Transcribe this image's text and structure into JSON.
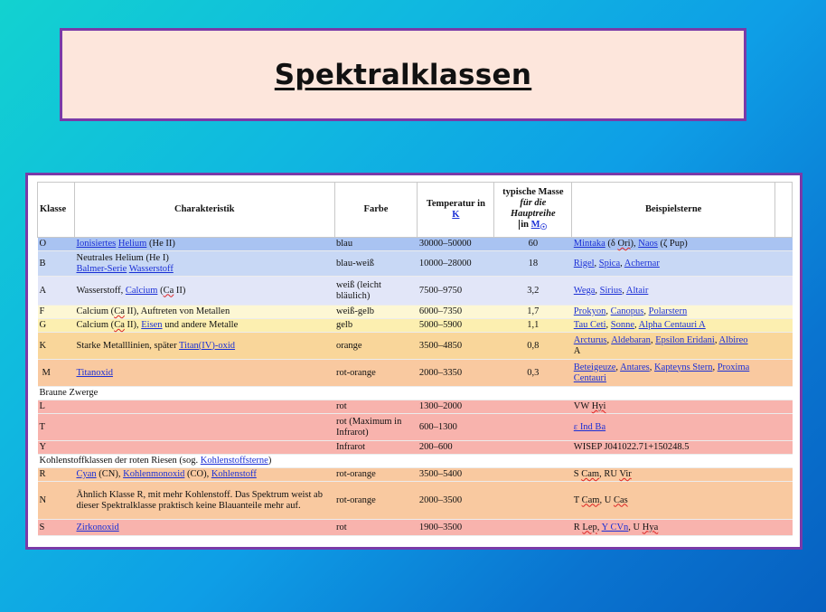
{
  "title": "Spektralklassen",
  "headers": {
    "klasse": "Klasse",
    "charakteristik": "Charakteristik",
    "farbe": "Farbe",
    "temperatur": "Temperatur in",
    "temperatur_unit": "K",
    "masse_line1": "typische Masse",
    "masse_line2": "für die",
    "masse_line3": "Hauptreihe",
    "masse_line4": "in",
    "masse_unit": "M",
    "masse_unit_sub": "☉",
    "beispiele": "Beispielsterne"
  },
  "rows": {
    "O": {
      "klasse": "O",
      "c1": "Ionisiertes",
      "c2": "Helium",
      "c3": " (He II)",
      "farbe": "blau",
      "temp": "30000–50000",
      "masse": "60",
      "b1": "Mintaka",
      "b2": " (δ ",
      "b3": "Ori",
      "b4": "), ",
      "b5": "Naos",
      "b6": " (ζ Pup)"
    },
    "B": {
      "klasse": "B",
      "c1": "Neutrales Helium  (He I)",
      "c2": "Balmer-Serie",
      "c3": "Wasserstoff",
      "farbe": "blau-weiß",
      "temp": "10000–28000",
      "masse": "18",
      "b1": "Rigel",
      "b2": "Spica",
      "b3": "Achernar"
    },
    "A": {
      "klasse": "A",
      "c1": "Wasserstoff, ",
      "c2": "Calcium",
      "c3": " (",
      "c4": "Ca",
      "c5": " II)",
      "farbe": "weiß (leicht bläulich)",
      "temp": "7500–9750",
      "masse": "3,2",
      "b1": "Wega",
      "b2": "Sirius",
      "b3": "Altair"
    },
    "F": {
      "klasse": "F",
      "c1": "Calcium (",
      "c2": "Ca",
      "c3": " II), Auftreten von Metallen",
      "farbe": "weiß-gelb",
      "temp": "6000–7350",
      "masse": "1,7",
      "b1": "Prokyon",
      "b2": "Canopus",
      "b3": "Polarstern"
    },
    "G": {
      "klasse": "G",
      "c1": "Calcium (",
      "c2": "Ca",
      "c3": " II), ",
      "c4": "Eisen",
      "c5": " und andere Metalle",
      "farbe": "gelb",
      "temp": "5000–5900",
      "masse": "1,1",
      "b1": "Tau Ceti",
      "b2": "Sonne",
      "b3": "Alpha Centauri A"
    },
    "K": {
      "klasse": "K",
      "c1": "Starke Metalllinien, später ",
      "c2": "Titan(IV)-oxid",
      "farbe": "orange",
      "temp": "3500–4850",
      "masse": "0,8",
      "b1": "Arcturus",
      "b2": "Aldebaran",
      "b3": "Epsilon Eridani",
      "b4": "Albireo",
      "b5": "A"
    },
    "M": {
      "klasse": "M",
      "c1": "Titanoxid",
      "farbe": "rot-orange",
      "temp": "2000–3350",
      "masse": "0,3",
      "b1": "Beteigeuze",
      "b2": "Antares",
      "b3": "Kapteyns Stern",
      "b4": "Proxima",
      "b5": "Centauri"
    },
    "braune": "Braune Zwerge",
    "L": {
      "klasse": "L",
      "farbe": "rot",
      "temp": "1300–2000",
      "b1": "VW ",
      "b2": "Hyi"
    },
    "T": {
      "klasse": "T",
      "farbe": "rot (Maximum in Infrarot)",
      "temp": "600–1300",
      "b1": "ε Ind Ba"
    },
    "Y": {
      "klasse": "Y",
      "farbe": "Infrarot",
      "temp": "200–600",
      "b1": "WISEP J041022.71+150248.5"
    },
    "kohlenstoff_pre": "Kohlenstoffklassen der roten Riesen (sog. ",
    "kohlenstoff_link": "Kohlenstoffsterne",
    "kohlenstoff_post": ")",
    "R": {
      "klasse": "R",
      "c1": "Cyan",
      "c2": " (CN), ",
      "c3": "Kohlenmonoxid",
      "c4": " (CO), ",
      "c5": "Kohlenstoff",
      "farbe": "rot-orange",
      "temp": "3500–5400",
      "b1": "S ",
      "b2": "Cam",
      "b3": ", RU ",
      "b4": "Vir"
    },
    "N": {
      "klasse": "N",
      "c1": "Ähnlich Klasse R, mit mehr Kohlenstoff. Das Spektrum weist ab dieser Spektralklasse praktisch keine Blauanteile mehr auf.",
      "farbe": "rot-orange",
      "temp": "2000–3500",
      "b1": "T ",
      "b2": "Cam",
      "b3": ", U ",
      "b4": "Cas"
    },
    "S": {
      "klasse": "S",
      "c1": "Zirkonoxid",
      "farbe": "rot",
      "temp": "1900–3500",
      "b1": "R ",
      "b2": "Lep",
      "b3": ", ",
      "b4": "Y CVn",
      "b5": ", U ",
      "b6": "Hya"
    }
  },
  "colors": {
    "frame": "#7a3aa8",
    "title_bg": "#fde6dc",
    "link": "#1a2fd6"
  }
}
